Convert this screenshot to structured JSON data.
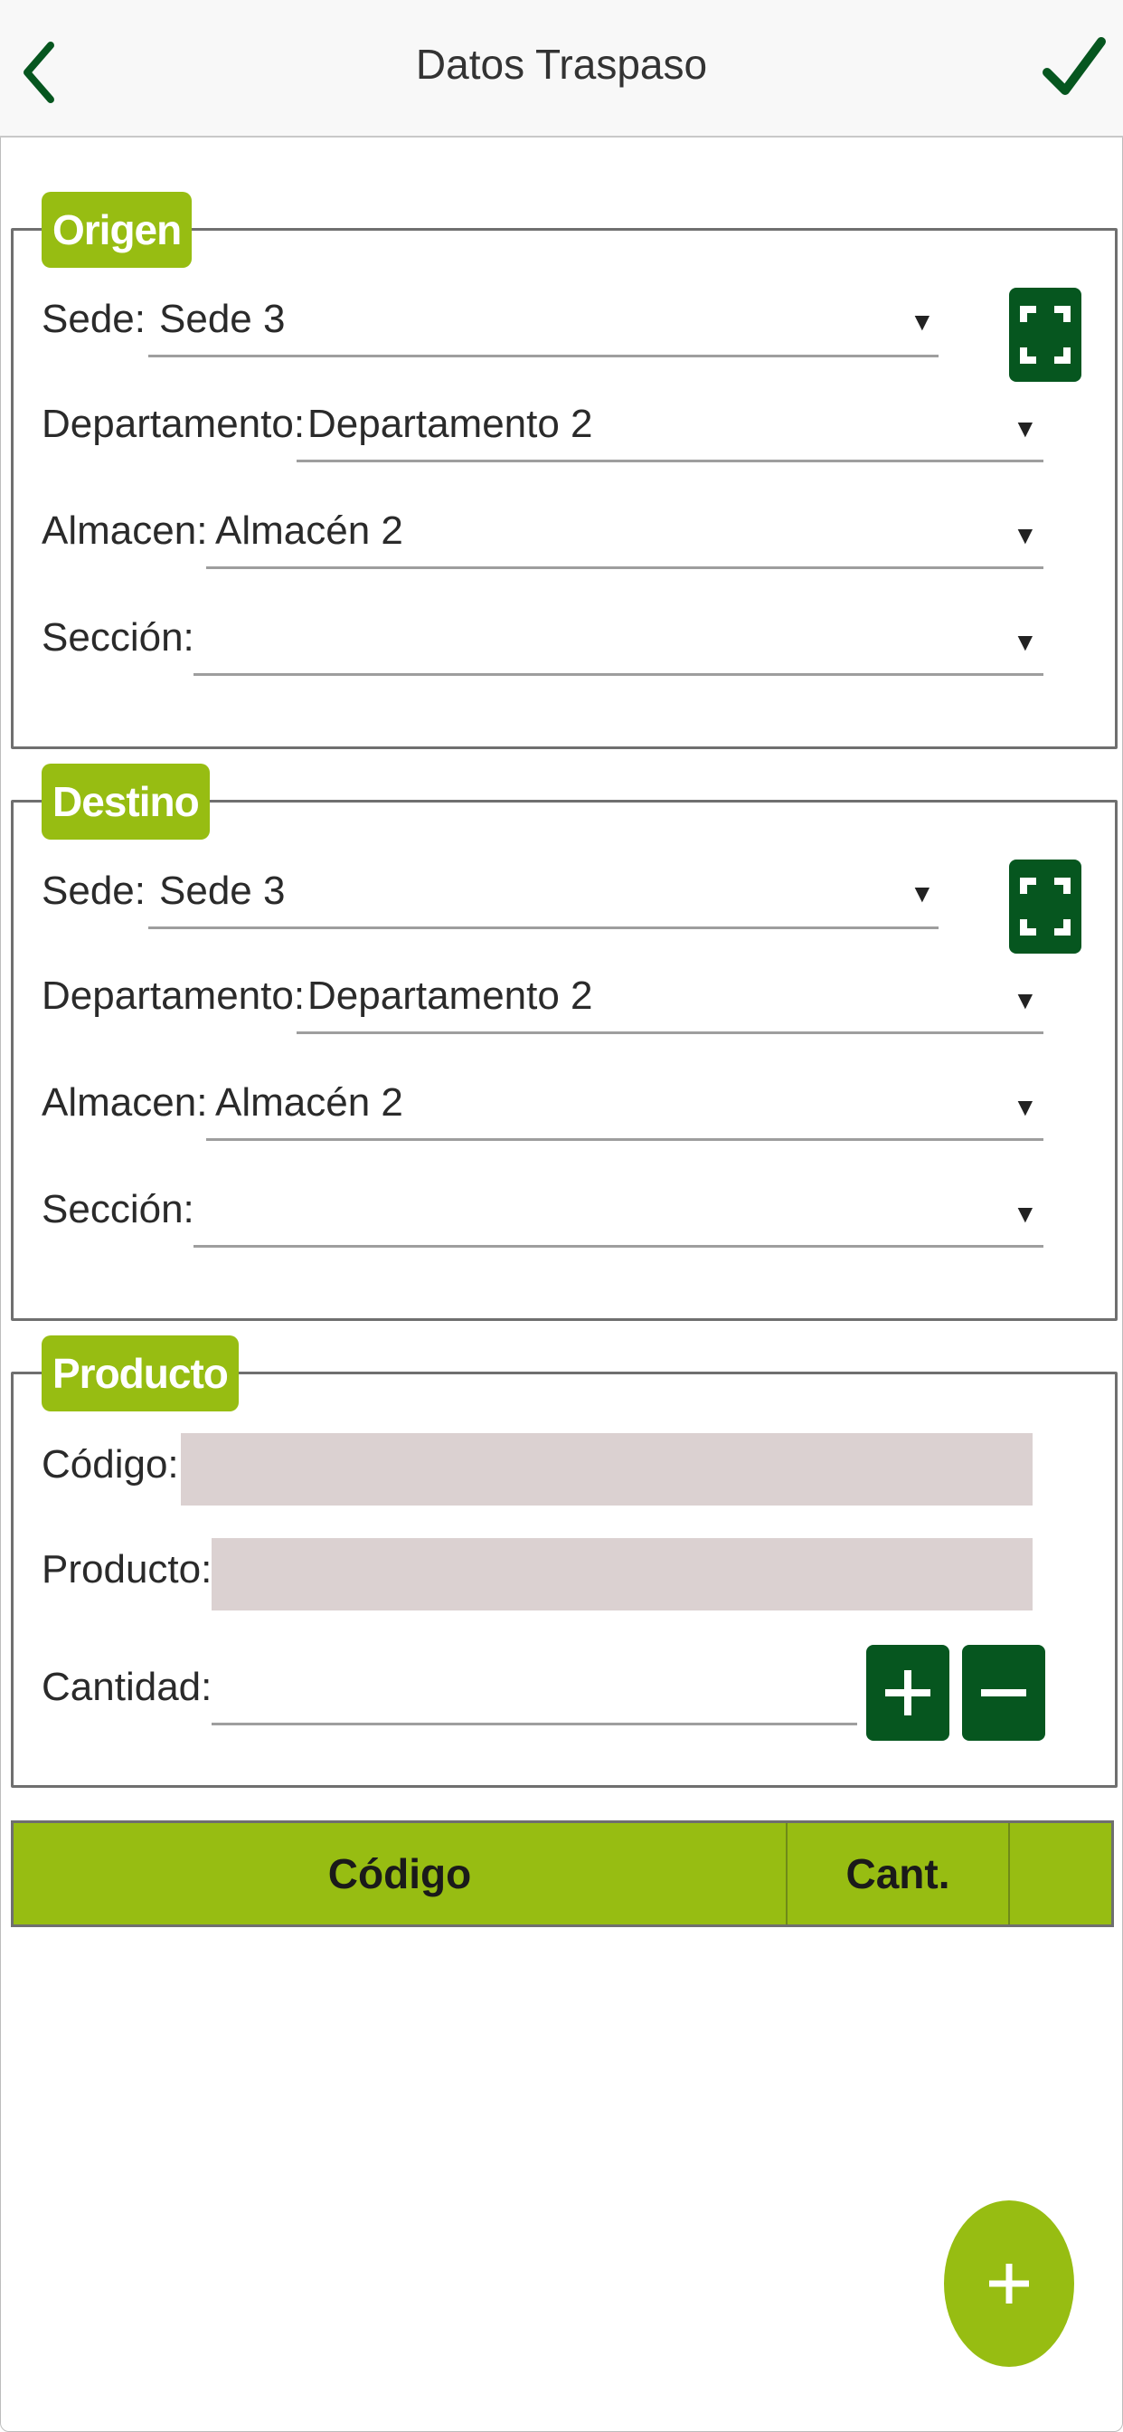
{
  "header": {
    "title": "Datos Traspaso",
    "back_icon": "chevron-left-icon",
    "confirm_icon": "check-icon"
  },
  "origen": {
    "legend": "Origen",
    "sede_label": "Sede:",
    "sede_value": "Sede 3",
    "departamento_label": "Departamento:",
    "departamento_value": "Departamento 2",
    "almacen_label": "Almacen:",
    "almacen_value": "Almacén 2",
    "seccion_label": "Sección:",
    "seccion_value": ""
  },
  "destino": {
    "legend": "Destino",
    "sede_label": "Sede:",
    "sede_value": "Sede 3",
    "departamento_label": "Departamento:",
    "departamento_value": "Departamento 2",
    "almacen_label": "Almacen:",
    "almacen_value": "Almacén 2",
    "seccion_label": "Sección:",
    "seccion_value": ""
  },
  "producto": {
    "legend": "Producto",
    "codigo_label": "Código:",
    "producto_label": "Producto:",
    "cantidad_label": "Cantidad:"
  },
  "table": {
    "columns": [
      "Código",
      "Cant.",
      ""
    ]
  },
  "colors": {
    "accent": "#97bd12",
    "dark_green": "#06561f",
    "readonly_field": "#dbd1d1"
  }
}
